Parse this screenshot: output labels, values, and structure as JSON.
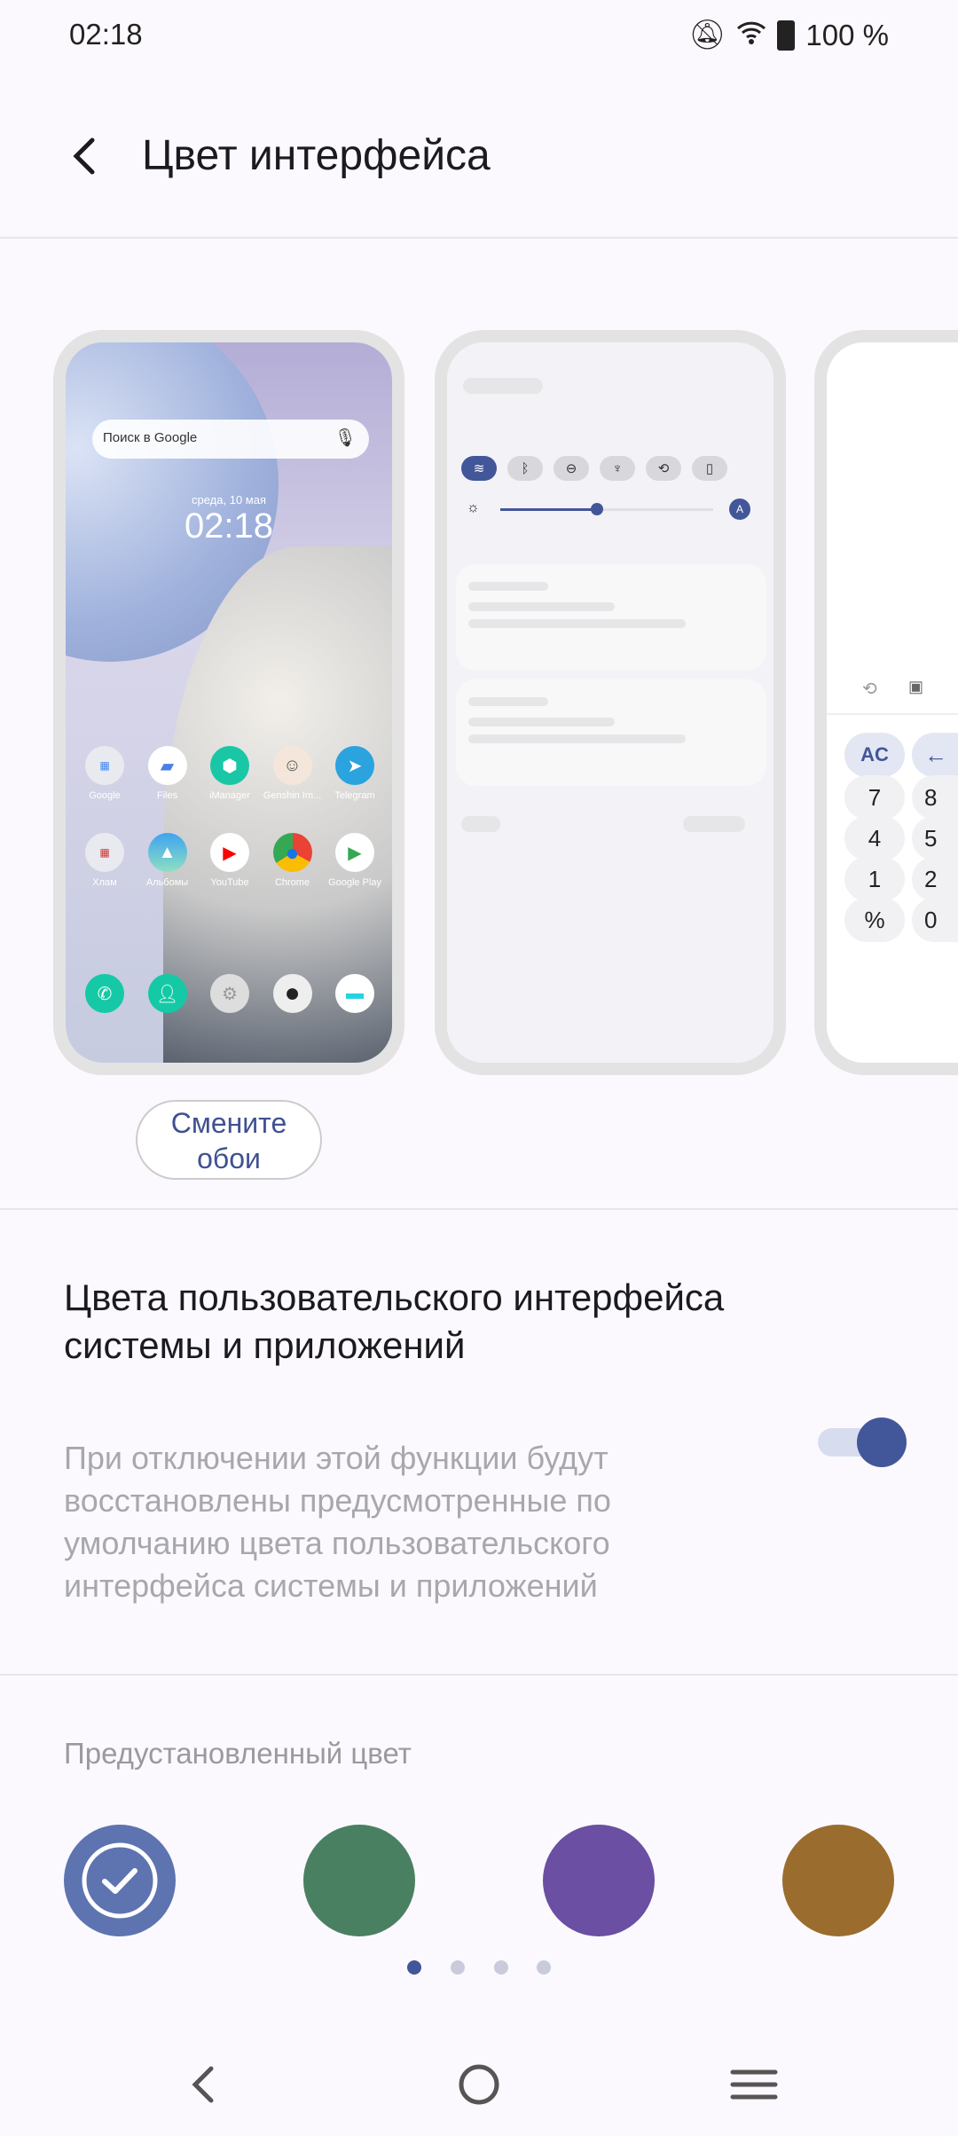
{
  "status": {
    "time": "02:18",
    "battery": "100 %",
    "icons": [
      "bell-off-icon",
      "wifi-icon",
      "battery-icon"
    ]
  },
  "header": {
    "title": "Цвет интерфейса",
    "back_icon": "arrow-back-icon"
  },
  "preview_home": {
    "search_placeholder": "Поиск в Google",
    "date": "среда, 10 мая",
    "clock": "02:18",
    "row1": [
      "Google",
      "Files",
      "iManager",
      "Genshin Im...",
      "Telegram"
    ],
    "row2": [
      "Хлам",
      "Альбомы",
      "YouTube",
      "Chrome",
      "Google Play"
    ]
  },
  "preview_calc": {
    "keys": [
      "AC",
      "←",
      "7",
      "8",
      "4",
      "5",
      "1",
      "2",
      "%",
      "0"
    ]
  },
  "wallpaper_button": "Смените обои",
  "system_colors": {
    "title": "Цвета пользовательского интерфейса системы и приложений",
    "description": "При отключении этой функции будут восстановлены предусмотренные по умолчанию цвета пользовательского интерфейса системы и приложений",
    "enabled": true
  },
  "preset": {
    "label": "Предустановленный цвет",
    "colors": [
      "#5e74b0",
      "#4a8062",
      "#6a4fa3",
      "#9a6d2e"
    ],
    "selected": 0,
    "page": 1,
    "pages": 4
  },
  "accent": "#42569a"
}
